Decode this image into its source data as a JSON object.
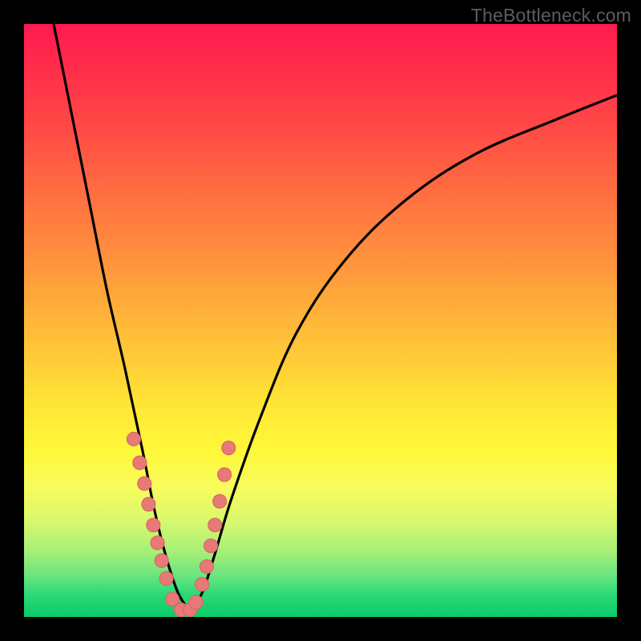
{
  "watermark": "TheBottleneck.com",
  "colors": {
    "frame": "#000000",
    "curve": "#000000",
    "dot_fill": "#e77a76",
    "dot_stroke": "#db6663",
    "gradient_top": "#ff1a50",
    "gradient_bottom": "#0acb6a"
  },
  "chart_data": {
    "type": "line",
    "title": "",
    "xlabel": "",
    "ylabel": "",
    "xlim": [
      0,
      100
    ],
    "ylim": [
      0,
      100
    ],
    "description": "Two bottleneck curves descending to a shared minimum near x≈25–30 over a vertical red→yellow→green gradient (green = low bottleneck). Pink dots mark sampled points near the minimum.",
    "series": [
      {
        "name": "left-curve",
        "role": "line",
        "x": [
          5,
          8,
          11,
          14,
          17,
          20,
          22,
          24,
          26,
          28
        ],
        "y": [
          100,
          85,
          70,
          55,
          42,
          28,
          18,
          10,
          4,
          1
        ]
      },
      {
        "name": "right-curve",
        "role": "line",
        "x": [
          28,
          30,
          32,
          35,
          40,
          46,
          54,
          64,
          76,
          90,
          100
        ],
        "y": [
          1,
          4,
          10,
          20,
          34,
          48,
          60,
          70,
          78,
          84,
          88
        ]
      },
      {
        "name": "sample-dots",
        "role": "scatter",
        "x": [
          18.5,
          19.5,
          20.3,
          21.0,
          21.8,
          22.5,
          23.2,
          24.0,
          25.0,
          26.5,
          28.0,
          29.0,
          30.0,
          30.8,
          31.5,
          32.2,
          33.0,
          33.8,
          34.5
        ],
        "y": [
          30.0,
          26.0,
          22.5,
          19.0,
          15.5,
          12.5,
          9.5,
          6.5,
          3.0,
          1.2,
          1.2,
          2.5,
          5.5,
          8.5,
          12.0,
          15.5,
          19.5,
          24.0,
          28.5
        ]
      }
    ]
  }
}
